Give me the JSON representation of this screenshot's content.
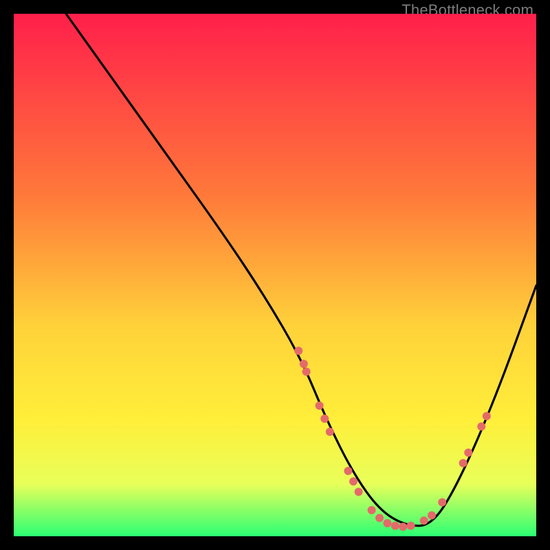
{
  "watermark": "TheBottleneck.com",
  "chart_data": {
    "type": "line",
    "title": "",
    "xlabel": "",
    "ylabel": "",
    "xlim": [
      0,
      100
    ],
    "ylim": [
      0,
      100
    ],
    "gradient_stops": [
      {
        "offset": 0,
        "color": "#ff1f4b"
      },
      {
        "offset": 35,
        "color": "#ff7a3a"
      },
      {
        "offset": 60,
        "color": "#ffd23a"
      },
      {
        "offset": 78,
        "color": "#ffef3a"
      },
      {
        "offset": 90,
        "color": "#e8ff5a"
      },
      {
        "offset": 100,
        "color": "#2bff73"
      }
    ],
    "curve": {
      "name": "bottleneck-curve",
      "x": [
        10,
        20,
        30,
        40,
        48,
        55,
        60,
        65,
        70,
        75,
        80,
        85,
        92,
        100
      ],
      "y": [
        100,
        86,
        72,
        58,
        46,
        34,
        22,
        12,
        5,
        2,
        2,
        10,
        26,
        48
      ]
    },
    "markers": {
      "name": "sample-points",
      "color": "#e46a6a",
      "radius_px": 6,
      "points": [
        {
          "x": 54.5,
          "y": 35.5
        },
        {
          "x": 55.5,
          "y": 33.0
        },
        {
          "x": 56.0,
          "y": 31.5
        },
        {
          "x": 58.5,
          "y": 25.0
        },
        {
          "x": 59.5,
          "y": 22.5
        },
        {
          "x": 60.5,
          "y": 20.0
        },
        {
          "x": 64.0,
          "y": 12.5
        },
        {
          "x": 65.0,
          "y": 10.5
        },
        {
          "x": 66.0,
          "y": 8.5
        },
        {
          "x": 68.5,
          "y": 5.0
        },
        {
          "x": 70.0,
          "y": 3.5
        },
        {
          "x": 71.5,
          "y": 2.5
        },
        {
          "x": 73.0,
          "y": 2.0
        },
        {
          "x": 74.5,
          "y": 1.8
        },
        {
          "x": 76.0,
          "y": 2.0
        },
        {
          "x": 78.5,
          "y": 3.0
        },
        {
          "x": 80.0,
          "y": 4.0
        },
        {
          "x": 82.0,
          "y": 6.5
        },
        {
          "x": 86.0,
          "y": 14.0
        },
        {
          "x": 87.0,
          "y": 16.0
        },
        {
          "x": 89.5,
          "y": 21.0
        },
        {
          "x": 90.5,
          "y": 23.0
        }
      ]
    }
  }
}
